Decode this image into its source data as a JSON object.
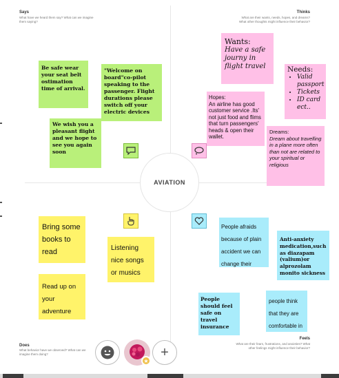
{
  "colors": {
    "says_note": "#b9f07a",
    "thinks_note": "#ffc0e7",
    "does_note": "#fff36a",
    "feels_note": "#a9ecfb"
  },
  "center": {
    "label": "AVIATION"
  },
  "quadrants": {
    "says": {
      "title": "Says",
      "subtitle": "What have we heard them say? What can we imagine them saying?",
      "icon": "speech-bubble-icon"
    },
    "thinks": {
      "title": "Thinks",
      "subtitle": "What are their wants, needs, hopes, and dreams? What other thoughts might influence their behavior?",
      "icon": "thought-bubble-icon"
    },
    "does": {
      "title": "Does",
      "subtitle": "What behavior have we observed? What can we imagine them doing?",
      "icon": "hand-pointer-icon"
    },
    "feels": {
      "title": "Feels",
      "subtitle": "What are their fears, frustrations, and anxieties? What other feelings might influence their behavior?",
      "icon": "heart-icon"
    }
  },
  "notes": {
    "says_1": "Be safe wear your seat belt ostimation time of arrival.",
    "says_2": "\"Welcome on board\"co-pilot speaking to the passenger. Flight durations please switch off your electric devices",
    "says_3": "We wish you a pleasant flight and we hope to see you again soon",
    "thinks_wants_title": "Wants:",
    "thinks_wants_body": "Have a safe journy in flight travel",
    "thinks_needs_title": "Needs:",
    "thinks_needs_items": [
      "Valid passport",
      "Tickets",
      "ID card ect.."
    ],
    "thinks_hopes_title": "Hopes:",
    "thinks_hopes_body": "An airline has good customer service .Its' not just food and flims that turn passengers' heads & open their wallet.",
    "thinks_dreams_title": "Dreams:",
    "thinks_dreams_body": "Dream about travelling in a plane more often than not are related to your spiritual or religious",
    "does_1": "Bring some books to read",
    "does_2": "Read up on your adventure",
    "does_3": "Listening nice songs or musics",
    "feels_1": "People afraids because of plain accident we can change their thoughts using averness camp",
    "feels_2": "Anti-anxiety medication,such as diazapam (valium)or alprozolam monito sickness .",
    "feels_3": "People should feel safe on travel insurance",
    "feels_4": "people think that they are comfortable in flight travelling"
  },
  "toolbar": {
    "emoji_icon": "smiley-face-icon",
    "add_icon": "plus-icon",
    "add_label": "+"
  }
}
